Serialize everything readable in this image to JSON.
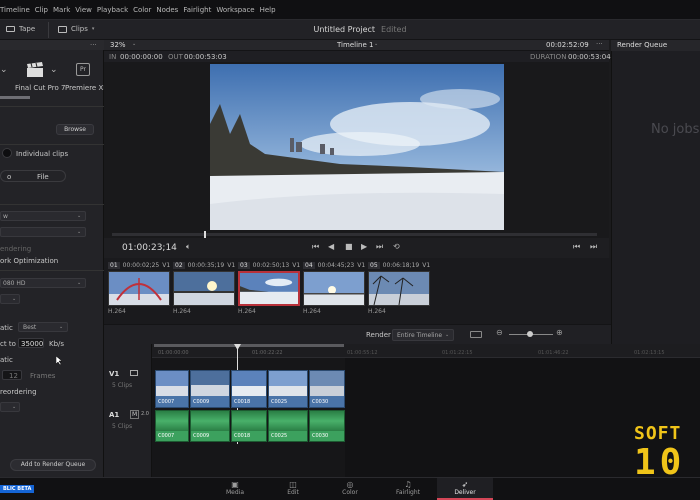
{
  "menu": [
    "Timeline",
    "Clip",
    "Mark",
    "View",
    "Playback",
    "Color",
    "Nodes",
    "Fairlight",
    "Workspace",
    "Help"
  ],
  "toolbar": {
    "tape": "Tape",
    "clips": "Clips"
  },
  "project": {
    "title": "Untitled Project",
    "status": "Edited"
  },
  "viewer": {
    "zoom": "32%",
    "timeline_name": "Timeline 1",
    "timecode_top": "00:02:52:09",
    "in_label": "IN",
    "in_value": "00:00:00:00",
    "out_label": "OUT",
    "out_value": "00:00:53:03",
    "duration_label": "DURATION",
    "duration_value": "00:00:53:04",
    "current_time": "01:00:23;14"
  },
  "render_queue": {
    "title": "Render Queue",
    "empty_text": "No jobs"
  },
  "left_panel": {
    "presets": [
      "Final Cut Pro 7",
      "Premiere XML"
    ],
    "browse": "Browse",
    "individual_clips": "Individual clips",
    "tabs": [
      "o",
      "File"
    ],
    "rendering_note": "endering",
    "network_opt": "ork Optimization",
    "resolution": "080 HD",
    "matic_label": "atic",
    "quality": "Best",
    "restrict_label": "ct to",
    "bitrate": "35000",
    "bitrate_unit": "Kb/s",
    "matic2": "atic",
    "frames_value": "12",
    "frames_unit": "Frames",
    "reordering": "reordering",
    "add_to_queue": "Add to Render Queue"
  },
  "clips": [
    {
      "num": "01",
      "tc": "00:00:02;25",
      "track": "V1",
      "format": "H.264"
    },
    {
      "num": "02",
      "tc": "00:00:35;19",
      "track": "V1",
      "format": "H.264"
    },
    {
      "num": "03",
      "tc": "00:02:50;13",
      "track": "V1",
      "format": "H.264"
    },
    {
      "num": "04",
      "tc": "00:04:45;23",
      "track": "V1",
      "format": "H.264"
    },
    {
      "num": "05",
      "tc": "00:06:18;19",
      "track": "V1",
      "format": "H.264"
    }
  ],
  "render_bar": {
    "label": "Render",
    "option": "Entire Timeline"
  },
  "timeline": {
    "ruler_marks": [
      "01:00:00:00",
      "01:00:22:22",
      "01:00:55:12",
      "01:01:22:15",
      "01:01:46:22",
      "01:02:13:15"
    ],
    "v1": {
      "name": "V1",
      "clips_text": "5 Clips"
    },
    "a1": {
      "name": "A1",
      "m": "M",
      "ch": "2.0",
      "clips_text": "5 Clips"
    },
    "video_clips": [
      "C0007",
      "C0009",
      "C0018",
      "C0025",
      "C0030"
    ],
    "audio_clips": [
      "C0007",
      "C0009",
      "C0018",
      "C0025",
      "C0030"
    ]
  },
  "pages": [
    {
      "label": "Media",
      "icon": "media-icon"
    },
    {
      "label": "Edit",
      "icon": "edit-icon"
    },
    {
      "label": "Color",
      "icon": "color-icon"
    },
    {
      "label": "Fairlight",
      "icon": "fairlight-icon"
    },
    {
      "label": "Deliver",
      "icon": "deliver-icon"
    }
  ],
  "badge": "BLIC BETA",
  "watermark": {
    "line1": "SOFT",
    "line2": "10"
  },
  "colors": {
    "accent": "#d44657",
    "video_clip": "#5f87b8",
    "audio_clip": "#2f8f4f",
    "beta_badge": "#1565d6",
    "watermark": "#f0c419"
  }
}
